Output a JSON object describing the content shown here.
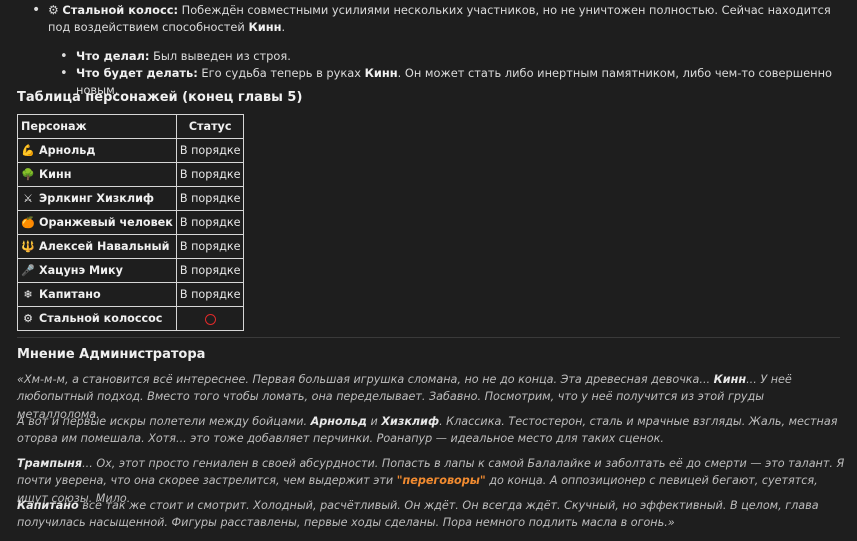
{
  "intro_item": {
    "icon": "gear-icon",
    "name": "Стальной колосс:",
    "text": " Побеждён совместными усилиями нескольких участников, но не уничтожен полностью. Сейчас находится под воздействием способностей ",
    "bold_tail": "Кинн",
    "tail_end": "."
  },
  "sub_items": [
    {
      "label": "Что делал:",
      "text": " Был выведен из строя."
    },
    {
      "label": "Что будет делать:",
      "text": " Его судьба теперь в руках ",
      "bold": "Кинн",
      "text2": ". Он может стать либо инертным памятником, либо чем-то совершенно новым."
    }
  ],
  "table": {
    "title": "Таблица персонажей (конец главы 5)",
    "headers": [
      "Персонаж",
      "Статус"
    ],
    "rows": [
      {
        "icon": "muscle-icon",
        "glyph": "💪",
        "name": "Арнольд",
        "status": "В порядке"
      },
      {
        "icon": "tree-icon",
        "glyph": "🌳",
        "name": "Кинн",
        "status": "В порядке"
      },
      {
        "icon": "crossed-swords-icon",
        "glyph": "⚔",
        "name": "Эрлкинг Хизклиф",
        "status": "В порядке"
      },
      {
        "icon": "orange-icon",
        "glyph": "🍊",
        "name": "Оранжевый человек",
        "status": "В порядке"
      },
      {
        "icon": "trident-icon",
        "glyph": "🔱",
        "name": "Алексей Навальный",
        "status": "В порядке"
      },
      {
        "icon": "microphone-icon",
        "glyph": "🎤",
        "name": "Хацунэ Мику",
        "status": "В порядке"
      },
      {
        "icon": "snowflake-icon",
        "glyph": "❄",
        "name": "Капитано",
        "status": "В порядке"
      },
      {
        "icon": "gear-icon",
        "glyph": "⚙",
        "name": "Стальной колоссос",
        "status": "",
        "status_icon": "red-circle-icon"
      }
    ]
  },
  "admin": {
    "title": "Мнение Администратора",
    "p1": {
      "a": "«Хм-м-м, а становится всё интереснее. Первая большая игрушка сломана, но не до конца. Эта древесная девочка... ",
      "b": "Кинн",
      "c": "... У неё любопытный подход. Вместо того чтобы ломать, она переделывает. Забавно. Посмотрим, что у неё получится из этой груды металлолома."
    },
    "p2": {
      "a": "А вот и первые искры полетели между бойцами. ",
      "b1": "Арнольд",
      "mid": " и ",
      "b2": "Хизклиф",
      "c": ". Классика. Тестостерон, сталь и мрачные взгляды. Жаль, местная оторва им помешала. Хотя... это тоже добавляет перчинки. Роанапур — идеальное место для таких сценок."
    },
    "p3": {
      "b": "Трампыня",
      "a": "... Ох, этот просто гениален в своей абсурдности. Попасть в лапы к самой Балалайке и заболтать её до смерти — это талант. Я почти уверена, что она скорее застрелится, чем выдержит эти ",
      "hl": "\"переговоры\"",
      "c": " до конца. А оппозиционер с певицей бегают, суетятся, ищут союзы. Мило."
    },
    "p4": {
      "b": "Капитано",
      "a": " всё так же стоит и смотрит. Холодный, расчётливый. Он ждёт. Он всегда ждёт. Скучный, но эффективный. В целом, глава получилась насыщенной. Фигуры расставлены, первые ходы сделаны. Пора немного подлить масла в огонь.»"
    }
  }
}
